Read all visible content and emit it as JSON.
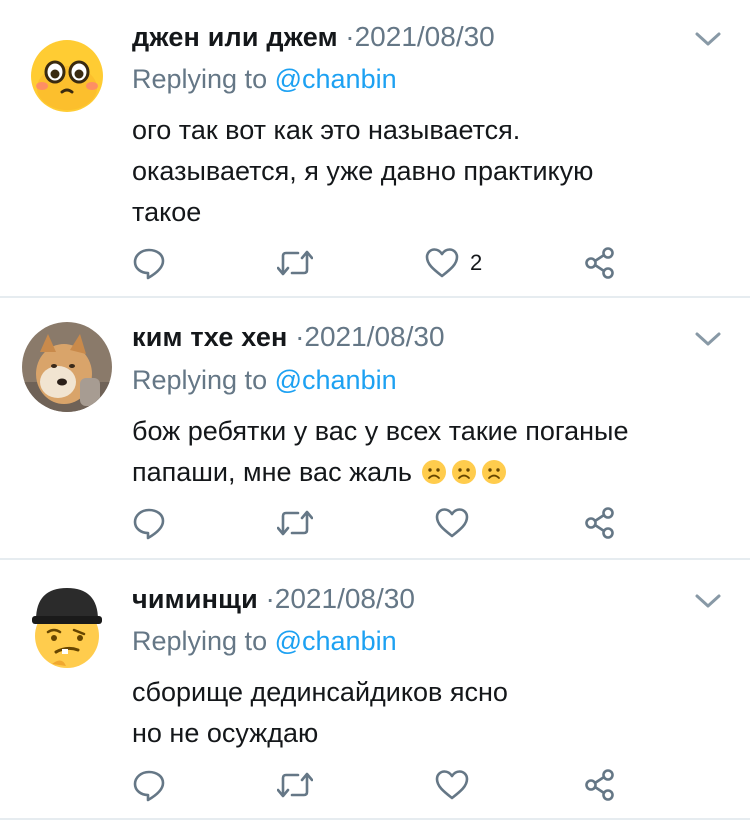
{
  "replies": [
    {
      "name": "джен или джем",
      "date": "·2021/08/30",
      "replying_label": "Replying to",
      "replying_handle": "@chanbin",
      "lines": [
        "ого так вот как это называется.",
        "оказывается, я уже давно практикую",
        "такое"
      ],
      "like_count": "2",
      "avatar_icon": "blushing-emoji-avatar"
    },
    {
      "name": "ким тхе хен",
      "date": "·2021/08/30",
      "replying_label": "Replying to",
      "replying_handle": "@chanbin",
      "lines": [
        "бож ребятки у вас у всех такие поганые",
        "папаши, мне вас жаль"
      ],
      "emojis": "☹️☹️☹️",
      "like_count": "",
      "avatar_icon": "dog-photo-avatar"
    },
    {
      "name": "чиминщи",
      "date": "·2021/08/30",
      "replying_label": "Replying to",
      "replying_handle": "@chanbin",
      "lines": [
        "сборище дединсайдиков ясно",
        "но не осуждаю"
      ],
      "like_count": "",
      "avatar_icon": "cap-emoji-avatar"
    }
  ],
  "colors": {
    "handle": "#1da1f2",
    "muted": "#657786",
    "icon": "#657786",
    "divider": "#e6ecf0"
  }
}
